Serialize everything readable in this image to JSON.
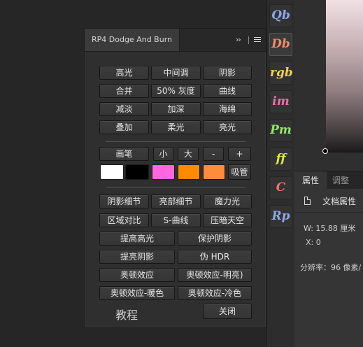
{
  "panel": {
    "title": "RP4 Dodge And Burn",
    "collapse_glyph": "››",
    "buttons": {
      "highlights": "高光",
      "midtones": "中间调",
      "shadows": "阴影",
      "merge": "合并",
      "gray50": "50% 灰度",
      "curves": "曲线",
      "fade": "减淡",
      "deepen": "加深",
      "sponge": "海绵",
      "overlay": "叠加",
      "soft_light": "柔光",
      "bright_light": "亮光",
      "brush": "画笔",
      "brush_small": "小",
      "brush_large": "大",
      "brush_minus": "-",
      "brush_plus": "+",
      "eyedropper": "吸管",
      "shadow_detail": "阴影细节",
      "highlight_detail": "亮部细节",
      "magic_light": "魔力光",
      "local_contrast": "区域对比",
      "s_curve": "S-曲线",
      "darken_pressure": "压暗天空",
      "boost_highlights": "提高高光",
      "protect_shadows": "保护阴影",
      "lift_shadows": "提亮阴影",
      "fake_hdr": "伪 HDR",
      "orton": "奥顿效应",
      "orton_bright": "奥顿效应-明亮)",
      "orton_warm": "奥顿效应-暖色",
      "orton_cool": "奥顿效应-冷色",
      "close": "关闭"
    },
    "swatches": [
      "#ffffff",
      "#000000",
      "#ff66e0",
      "#ff8a00",
      "#ff8c3a"
    ],
    "tutorial": "教程"
  },
  "toolstrip": {
    "items": [
      {
        "label": "Qb",
        "color": "#8fa7e8"
      },
      {
        "label": "Db",
        "color": "#f08a6a"
      },
      {
        "label": "rgb",
        "color": "#f2d24a"
      },
      {
        "label": "im",
        "color": "#ef6fa8"
      },
      {
        "label": "Pm",
        "color": "#8ee86a"
      },
      {
        "label": "ff",
        "color": "#d8e84a"
      },
      {
        "label": "C",
        "color": "#ff6f6f"
      },
      {
        "label": "Rp",
        "color": "#8fa7e8"
      }
    ]
  },
  "properties": {
    "tab_active": "属性",
    "tab_other": "调整",
    "doc_label": "文档属性",
    "width_text": "W:  15.88  厘米",
    "x_text": "X:  0",
    "resolution_text": "分辨率：96 像素/"
  }
}
